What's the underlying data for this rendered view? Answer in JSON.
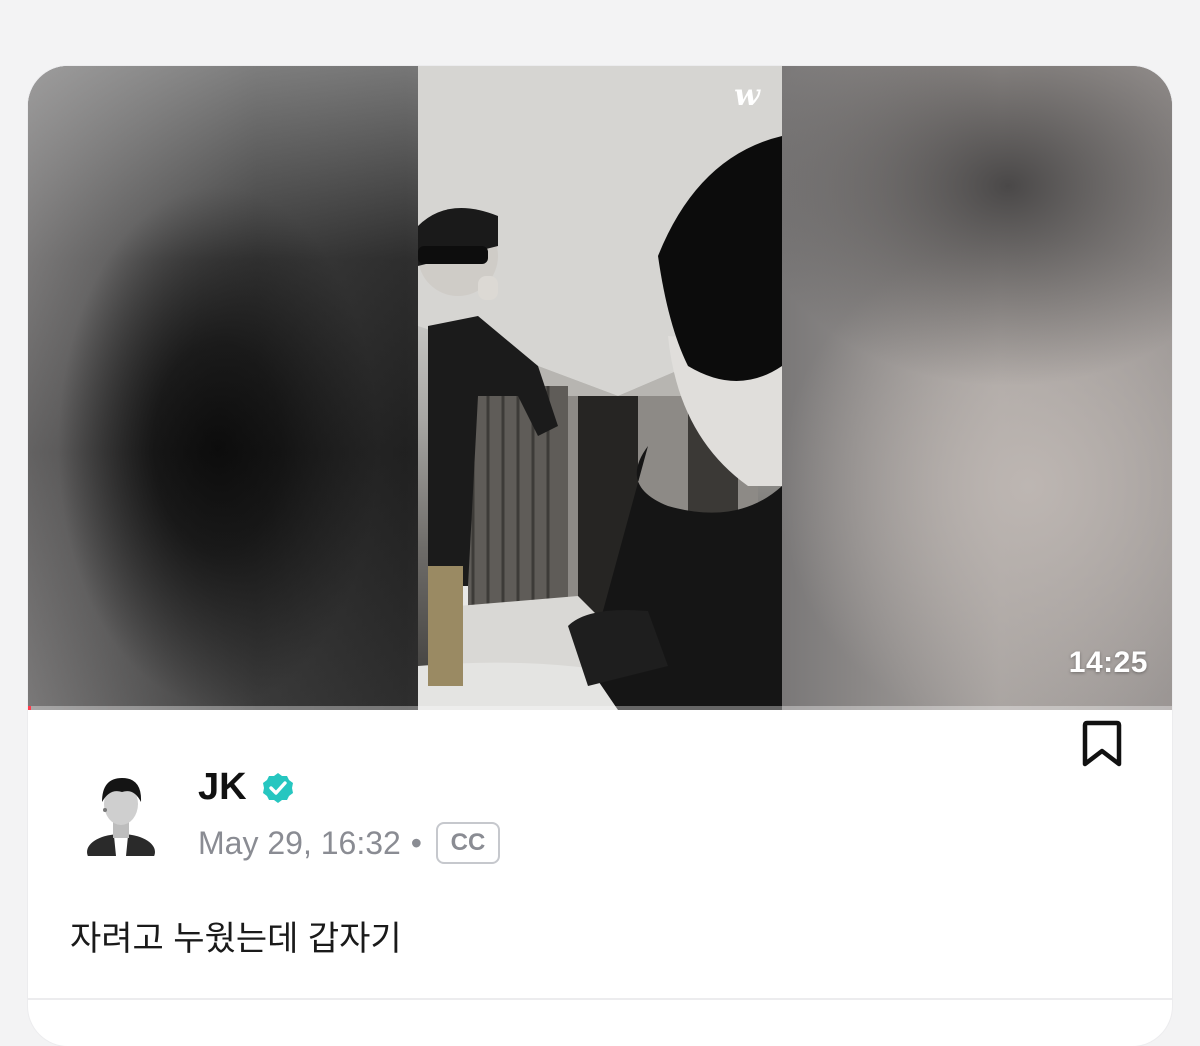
{
  "video": {
    "logo": "w",
    "duration": "14:25",
    "progress_fraction": 0.003
  },
  "post": {
    "author": "JK",
    "verified": true,
    "date": "May 29, 16:32",
    "separator": "•",
    "cc_label": "CC",
    "caption": "자려고 누웠는데 갑자기"
  },
  "colors": {
    "verified_badge": "#26c6c0",
    "progress": "#ff3b4c"
  },
  "icons": [
    "weverse-logo-icon",
    "verified-icon",
    "bookmark-icon",
    "avatar"
  ]
}
